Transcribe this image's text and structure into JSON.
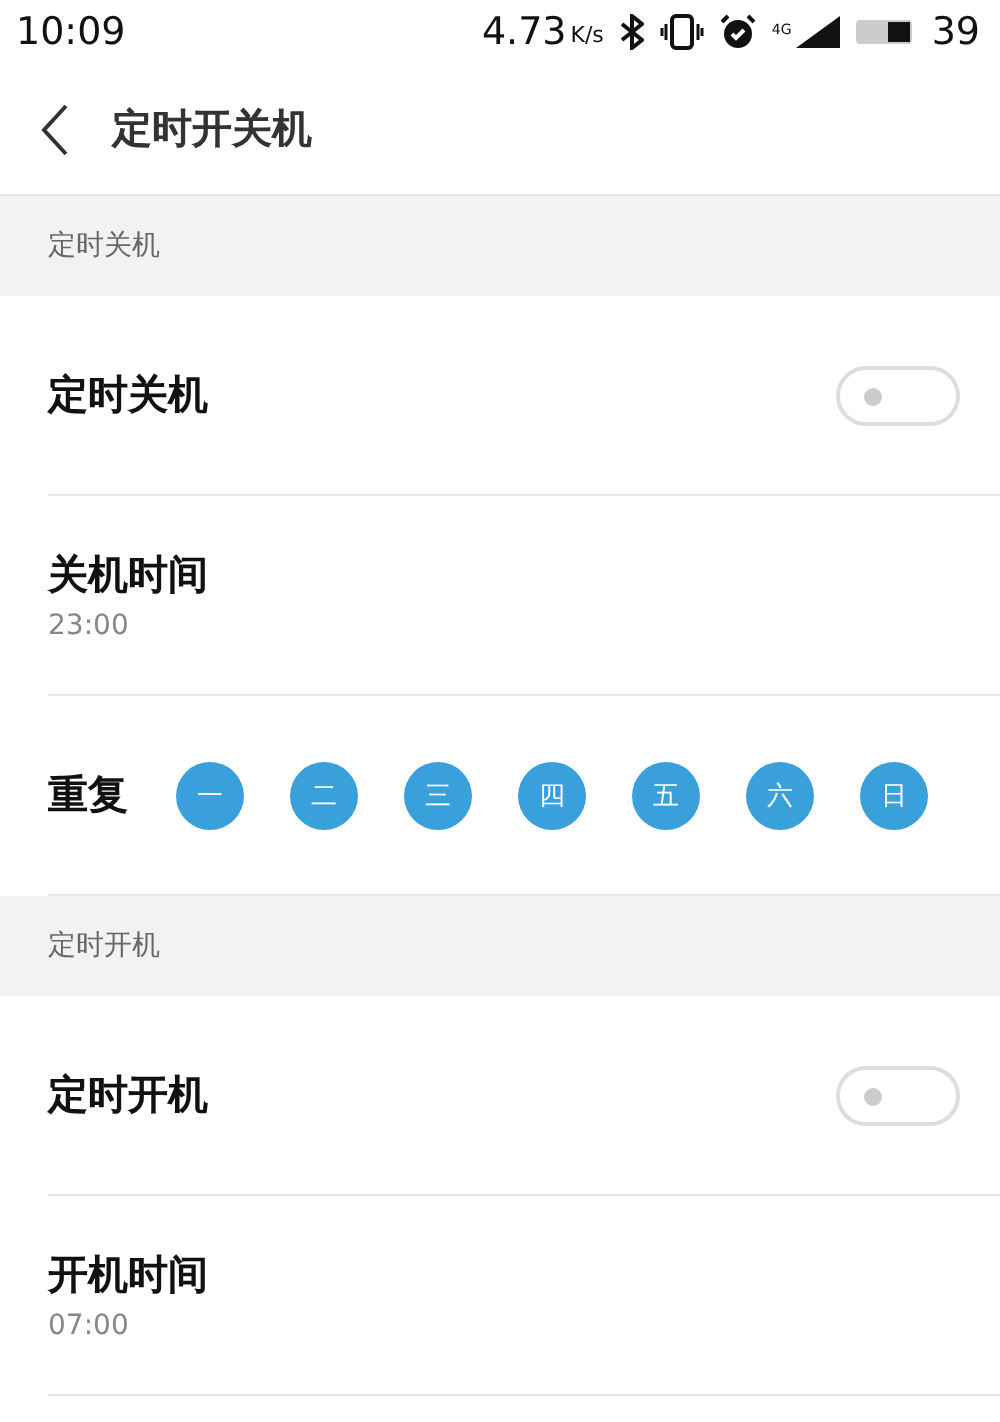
{
  "status_bar": {
    "time": "10:09",
    "speed": "4.73",
    "speed_unit": "K/s",
    "network": "4G",
    "battery": "39"
  },
  "header": {
    "title": "定时开关机"
  },
  "sections": [
    {
      "title": "定时关机",
      "rows": [
        {
          "kind": "toggle",
          "label": "定时关机",
          "on": false
        },
        {
          "kind": "time",
          "label": "关机时间",
          "value": "23:00"
        },
        {
          "kind": "repeat",
          "label": "重复",
          "days": [
            {
              "label": "一",
              "selected": true
            },
            {
              "label": "二",
              "selected": true
            },
            {
              "label": "三",
              "selected": true
            },
            {
              "label": "四",
              "selected": true
            },
            {
              "label": "五",
              "selected": true
            },
            {
              "label": "六",
              "selected": true
            },
            {
              "label": "日",
              "selected": true
            }
          ]
        }
      ]
    },
    {
      "title": "定时开机",
      "rows": [
        {
          "kind": "toggle",
          "label": "定时开机",
          "on": false
        },
        {
          "kind": "time",
          "label": "开机时间",
          "value": "07:00"
        }
      ]
    }
  ]
}
